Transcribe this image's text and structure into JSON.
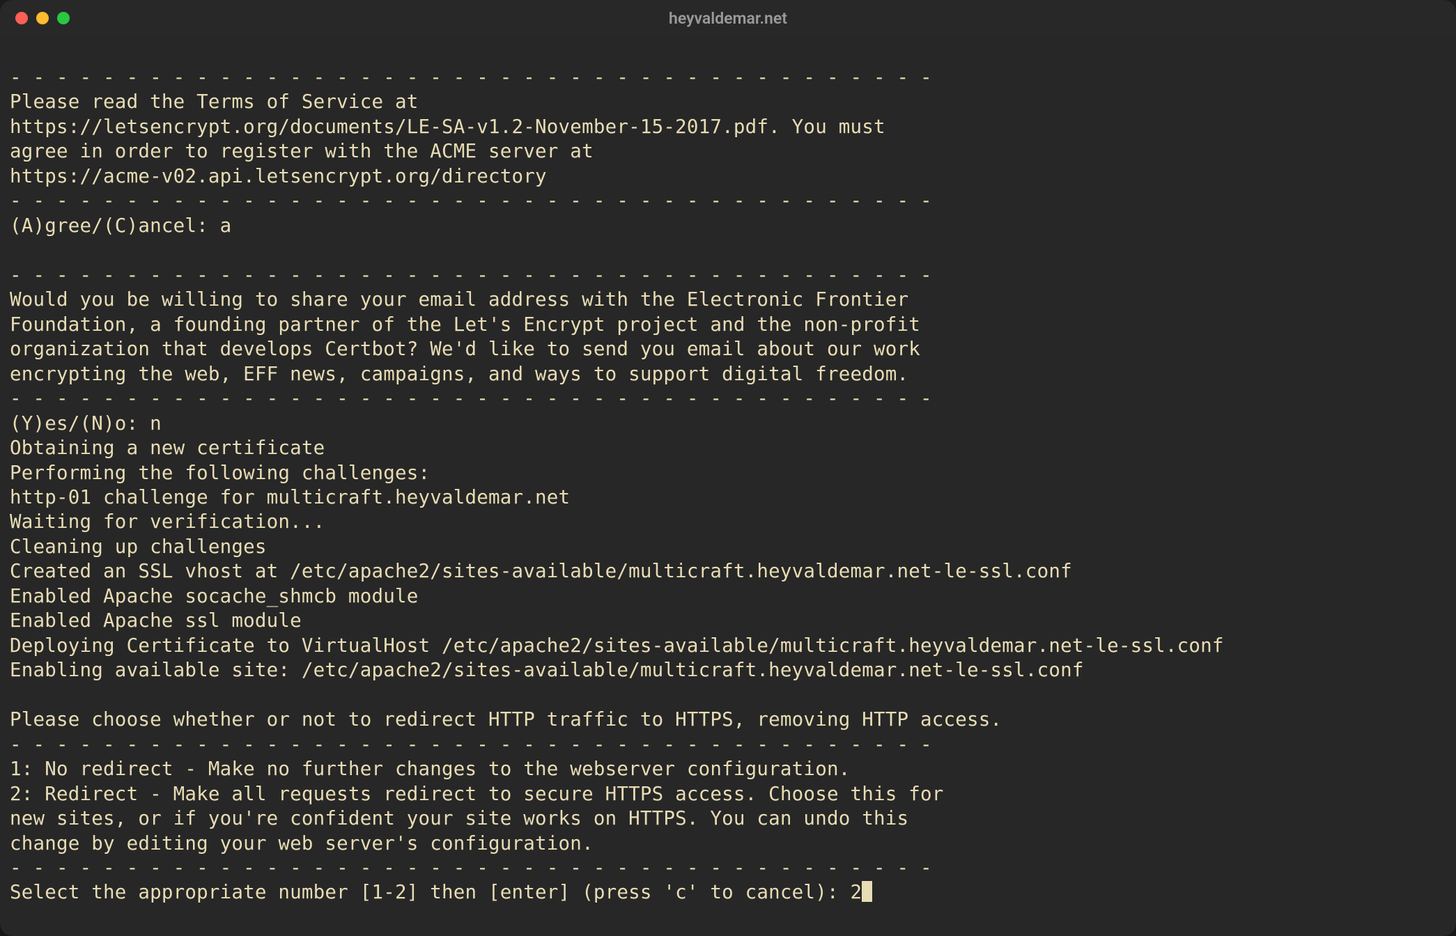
{
  "window": {
    "title": "heyvaldemar.net"
  },
  "terminal": {
    "lines": [
      "- - - - - - - - - - - - - - - - - - - - - - - - - - - - - - - - - - - - - - - -",
      "Please read the Terms of Service at",
      "https://letsencrypt.org/documents/LE-SA-v1.2-November-15-2017.pdf. You must",
      "agree in order to register with the ACME server at",
      "https://acme-v02.api.letsencrypt.org/directory",
      "- - - - - - - - - - - - - - - - - - - - - - - - - - - - - - - - - - - - - - - -",
      "(A)gree/(C)ancel: a",
      "",
      "- - - - - - - - - - - - - - - - - - - - - - - - - - - - - - - - - - - - - - - -",
      "Would you be willing to share your email address with the Electronic Frontier",
      "Foundation, a founding partner of the Let's Encrypt project and the non-profit",
      "organization that develops Certbot? We'd like to send you email about our work",
      "encrypting the web, EFF news, campaigns, and ways to support digital freedom.",
      "- - - - - - - - - - - - - - - - - - - - - - - - - - - - - - - - - - - - - - - -",
      "(Y)es/(N)o: n",
      "Obtaining a new certificate",
      "Performing the following challenges:",
      "http-01 challenge for multicraft.heyvaldemar.net",
      "Waiting for verification...",
      "Cleaning up challenges",
      "Created an SSL vhost at /etc/apache2/sites-available/multicraft.heyvaldemar.net-le-ssl.conf",
      "Enabled Apache socache_shmcb module",
      "Enabled Apache ssl module",
      "Deploying Certificate to VirtualHost /etc/apache2/sites-available/multicraft.heyvaldemar.net-le-ssl.conf",
      "Enabling available site: /etc/apache2/sites-available/multicraft.heyvaldemar.net-le-ssl.conf",
      "",
      "Please choose whether or not to redirect HTTP traffic to HTTPS, removing HTTP access.",
      "- - - - - - - - - - - - - - - - - - - - - - - - - - - - - - - - - - - - - - - -",
      "1: No redirect - Make no further changes to the webserver configuration.",
      "2: Redirect - Make all requests redirect to secure HTTPS access. Choose this for",
      "new sites, or if you're confident your site works on HTTPS. You can undo this",
      "change by editing your web server's configuration.",
      "- - - - - - - - - - - - - - - - - - - - - - - - - - - - - - - - - - - - - - - -"
    ],
    "prompt_line": "Select the appropriate number [1-2] then [enter] (press 'c' to cancel): 2"
  }
}
